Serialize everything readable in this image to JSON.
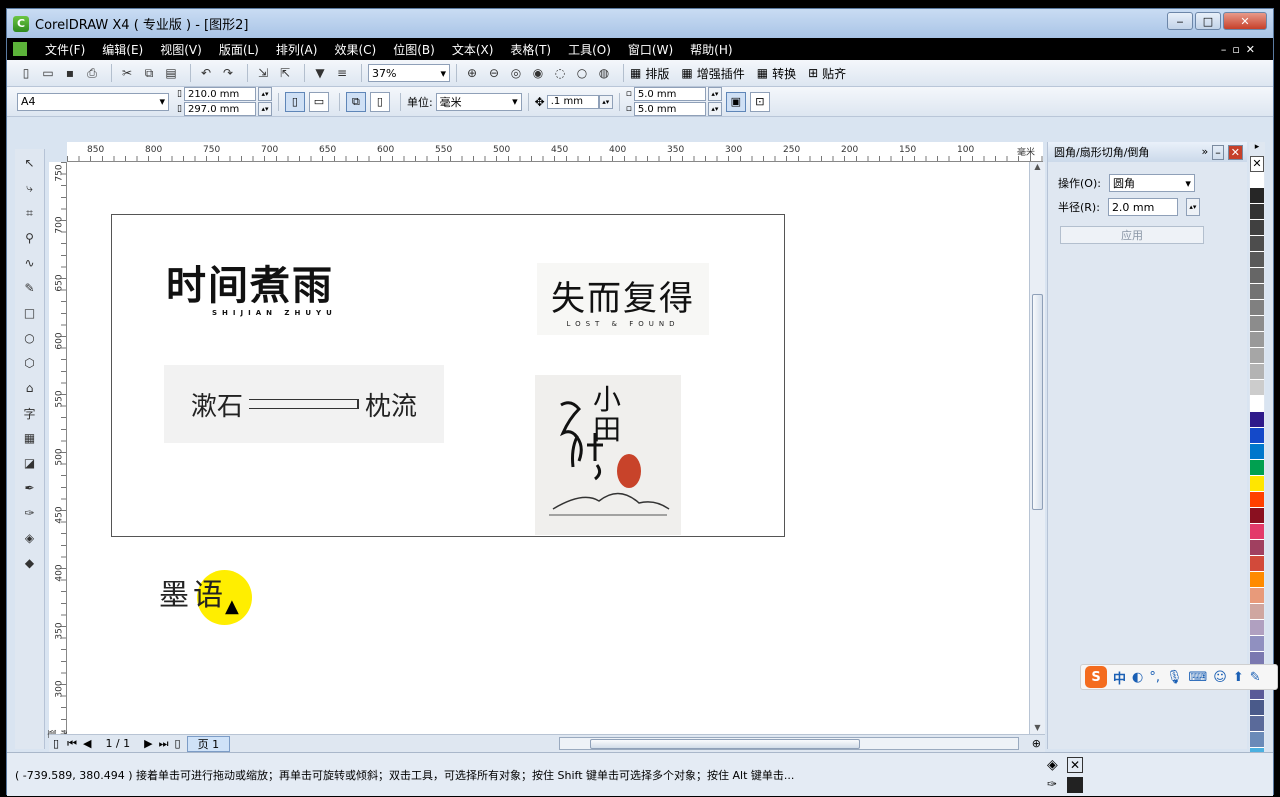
{
  "window": {
    "title": "CorelDRAW X4 ( 专业版 ) - [图形2]"
  },
  "menu": [
    "文件(F)",
    "编辑(E)",
    "视图(V)",
    "版面(L)",
    "排列(A)",
    "效果(C)",
    "位图(B)",
    "文本(X)",
    "表格(T)",
    "工具(O)",
    "窗口(W)",
    "帮助(H)"
  ],
  "toolbar1": {
    "zoom": "37%",
    "layout_label": "排版",
    "plugin_label": "增强插件",
    "convert_label": "转换",
    "paste_label": "贴齐"
  },
  "toolbar2": {
    "paper": "A4",
    "width": "210.0 mm",
    "height": "297.0 mm",
    "unit_label": "单位:",
    "unit": "毫米",
    "nudge": ".1 mm",
    "dup_x": "5.0 mm",
    "dup_y": "5.0 mm"
  },
  "ruler": {
    "h_ticks": [
      "850",
      "800",
      "750",
      "700",
      "650",
      "600",
      "550",
      "500",
      "450",
      "400",
      "350",
      "300",
      "250",
      "200",
      "150",
      "100"
    ],
    "h_unit": "毫米",
    "v_ticks": [
      "750",
      "700",
      "650",
      "600",
      "550",
      "500",
      "450",
      "400",
      "350",
      "300"
    ],
    "v_unit": "毫米"
  },
  "canvas": {
    "logo1_main": "时间煮雨",
    "logo1_sub": "SHIJIAN  ZHUYU",
    "logo2_main": "失而复得",
    "logo2_sub": "LOST  &  FOUND",
    "logo3_left": "漱石",
    "logo3_right": "枕流",
    "logo4_text": "小田",
    "moyu": "墨语"
  },
  "pager": {
    "page_count": "1 / 1",
    "page_tab": "页 1"
  },
  "docker": {
    "title": "圆角/扇形切角/倒角",
    "operation_label": "操作(O):",
    "operation_value": "圆角",
    "radius_label": "半径(R):",
    "radius_value": "2.0 mm",
    "apply_label": "应用"
  },
  "palette_colors": [
    "#ffffff",
    "#262626",
    "#333333",
    "#404040",
    "#4d4d4d",
    "#595959",
    "#666666",
    "#737373",
    "#808080",
    "#8c8c8c",
    "#999999",
    "#a6a6a6",
    "#b3b3b3",
    "#cccccc",
    "#ffffff",
    "#2e1a8a",
    "#1449c9",
    "#0077cc",
    "#00a050",
    "#ffe600",
    "#ff4000",
    "#8a1020",
    "#e33a6a",
    "#a04060",
    "#d24a3a",
    "#ff8a00",
    "#e89a7a",
    "#cfa6a0",
    "#b0a0c0",
    "#9090c0",
    "#7a78b0",
    "#6a6aa8",
    "#5a5a98",
    "#4a5a8a",
    "#5a6a9a",
    "#6a8ab8",
    "#4ab0e0"
  ],
  "status": {
    "coords": "( -739.589, 380.494 )",
    "message": "接着单击可进行拖动或缩放；再单击可旋转或倾斜；双击工具，可选择所有对象；按住 Shift 键单击可选择多个对象；按住 Alt 键单击..."
  },
  "ime": {
    "label": "中"
  }
}
